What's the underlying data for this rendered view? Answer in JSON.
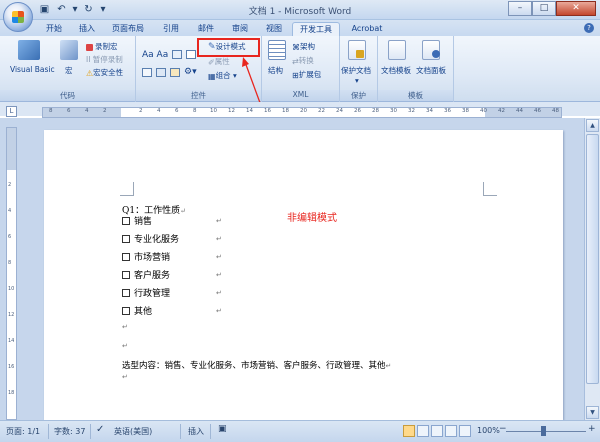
{
  "window": {
    "title": "文档 1 - Microsoft Word"
  },
  "tabs": [
    {
      "label": "开始"
    },
    {
      "label": "插入"
    },
    {
      "label": "页面布局"
    },
    {
      "label": "引用"
    },
    {
      "label": "邮件"
    },
    {
      "label": "审阅"
    },
    {
      "label": "视图"
    },
    {
      "label": "开发工具"
    },
    {
      "label": "Acrobat"
    }
  ],
  "ribbon": {
    "code": {
      "label": "代码",
      "visual_basic": "Visual Basic",
      "macro": "宏",
      "record_macro": "录制宏",
      "pause_recording": "II 暂停录制",
      "macro_security": "宏安全性"
    },
    "controls": {
      "label": "控件",
      "design_mode": "设计模式",
      "properties": "属性",
      "group": "组合"
    },
    "xml": {
      "label": "XML",
      "structure": "结构",
      "schema": "架构",
      "transform": "转换",
      "expansion_packs": "扩展包"
    },
    "protect": {
      "label": "保护",
      "protect_document": "保护文档"
    },
    "templates": {
      "label": "模板",
      "document_template": "文档模板",
      "document_panel": "文档面板"
    }
  },
  "ruler": {
    "h_numbers": [
      "8",
      "6",
      "4",
      "2",
      "",
      "2",
      "4",
      "6",
      "8",
      "10",
      "12",
      "14",
      "16",
      "18",
      "20",
      "22",
      "24",
      "26",
      "28",
      "30",
      "32",
      "34",
      "36",
      "38",
      "40",
      "42",
      "44",
      "46",
      "48"
    ],
    "v_numbers": [
      "2",
      "4",
      "6",
      "8",
      "10",
      "12",
      "14",
      "16",
      "18"
    ]
  },
  "document": {
    "question": "Q1：工作性质",
    "options": [
      "销售",
      "专业化服务",
      "市场营销",
      "客户服务",
      "行政管理",
      "其他"
    ],
    "selected_text": "选型内容：销售、专业化服务、市场营销、客户服务、行政管理、其他"
  },
  "annotation": {
    "text": "非编辑模式",
    "color": "#e8261f"
  },
  "status": {
    "page": "页面: 1/1",
    "words": "字数: 37",
    "language": "英语(美国)",
    "insert_mode": "插入",
    "zoom": "100%"
  }
}
